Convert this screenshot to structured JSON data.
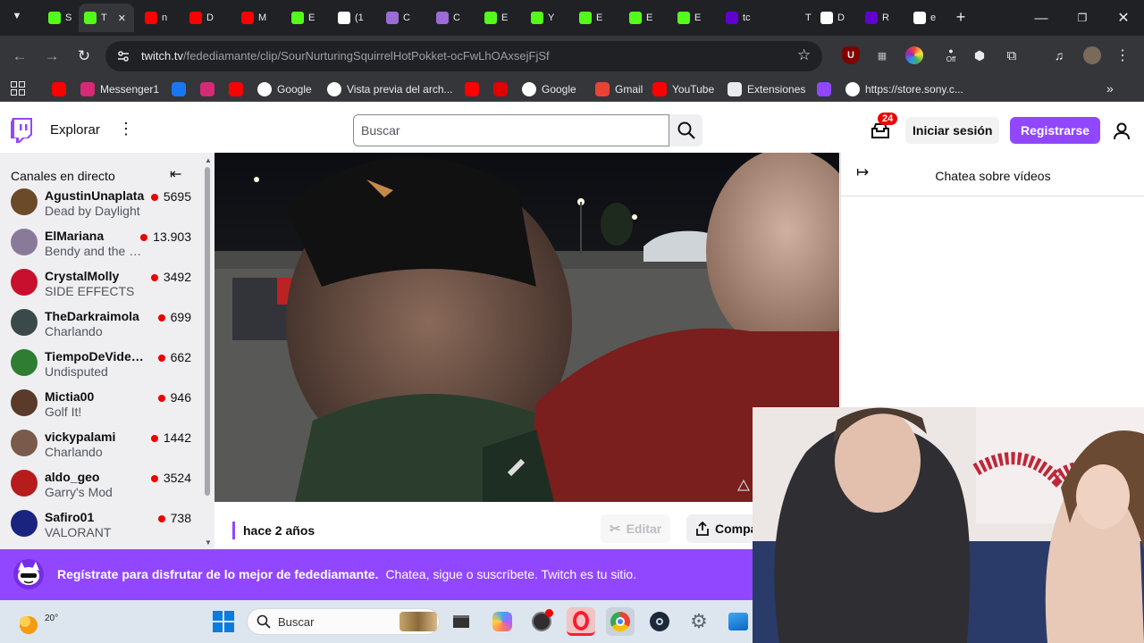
{
  "browser": {
    "tabs": [
      {
        "letter": "S",
        "icon": "kick-icon",
        "color": "#53fc18"
      },
      {
        "letter": "T",
        "icon": "kick-icon",
        "color": "#53fc18",
        "active": true
      },
      {
        "letter": "n",
        "icon": "youtube-icon",
        "color": "#ff0000"
      },
      {
        "letter": "D",
        "icon": "youtube-icon",
        "color": "#ff0000"
      },
      {
        "letter": "M",
        "icon": "youtube-icon",
        "color": "#ff0000"
      },
      {
        "letter": "E",
        "icon": "kick-icon",
        "color": "#53fc18"
      },
      {
        "letter": "(1",
        "icon": "tiktok-icon",
        "color": "#ffffff"
      },
      {
        "letter": "C",
        "icon": "feather-icon",
        "color": "#9b6bd6"
      },
      {
        "letter": "C",
        "icon": "feather-icon",
        "color": "#9b6bd6"
      },
      {
        "letter": "E",
        "icon": "kick-icon",
        "color": "#53fc18"
      },
      {
        "letter": "Y",
        "icon": "kick-icon",
        "color": "#53fc18"
      },
      {
        "letter": "E",
        "icon": "kick-icon",
        "color": "#53fc18"
      },
      {
        "letter": "E",
        "icon": "kick-icon",
        "color": "#53fc18"
      },
      {
        "letter": "E",
        "icon": "kick-icon",
        "color": "#53fc18"
      },
      {
        "letter": "tc",
        "icon": "yahoo-icon",
        "color": "#6001d2"
      },
      {
        "letter": "T",
        "icon": "blank-icon",
        "color": "#202124"
      },
      {
        "letter": "D",
        "icon": "tiktok-icon",
        "color": "#ffffff"
      },
      {
        "letter": "R",
        "icon": "yahoo-icon",
        "color": "#6001d2"
      },
      {
        "letter": "e",
        "icon": "google-icon",
        "color": "#ffffff"
      }
    ],
    "url_domain": "twitch.tv",
    "url_path": "/fedediamante/clip/SourNurturingSquirrelHotPokket-ocFwLhOAxsejFjSf",
    "bookmarks": [
      {
        "label": "",
        "icon": "youtube-icon",
        "color": "#ff0000"
      },
      {
        "label": "Messenger1",
        "icon": "instagram-icon",
        "color": "#d62976"
      },
      {
        "label": "",
        "icon": "facebook-icon",
        "color": "#1877f2"
      },
      {
        "label": "",
        "icon": "instagram-icon",
        "color": "#d62976"
      },
      {
        "label": "",
        "icon": "youtube-icon",
        "color": "#ff0000"
      },
      {
        "label": "Google",
        "icon": "google-icon",
        "color": "#ffffff"
      },
      {
        "label": "Vista previa del arch...",
        "icon": "globe-icon",
        "color": "#ffffff"
      },
      {
        "label": "",
        "icon": "youtube-icon",
        "color": "#ff0000"
      },
      {
        "label": "",
        "icon": "red-logo-icon",
        "color": "#e00000"
      },
      {
        "label": "Google",
        "icon": "google-icon",
        "color": "#ffffff"
      },
      {
        "label": "Gmail",
        "icon": "gmail-icon",
        "color": "#ea4335"
      },
      {
        "label": "YouTube",
        "icon": "youtube-icon",
        "color": "#ff0000"
      },
      {
        "label": "Extensiones",
        "icon": "puzzle-icon",
        "color": "#e8eaed"
      },
      {
        "label": "",
        "icon": "twitch-icon",
        "color": "#9147ff"
      },
      {
        "label": "https://store.sony.c...",
        "icon": "sony-icon",
        "color": "#ffffff"
      }
    ]
  },
  "twitch": {
    "accent": "#9147ff",
    "nav": {
      "explore": "Explorar",
      "search_placeholder": "Buscar",
      "notif_count": "24",
      "login": "Iniciar sesión",
      "signup": "Registrarse"
    },
    "sidebar": {
      "title": "Canales en directo",
      "channels": [
        {
          "name": "AgustinUnaplata",
          "game": "Dead by Daylight",
          "viewers": "5695",
          "avatar": "#6b4a2a"
        },
        {
          "name": "ElMariana",
          "game": "Bendy and the Ink Machine",
          "viewers": "13.903",
          "avatar": "#8a7a9a"
        },
        {
          "name": "CrystalMolly",
          "game": "SIDE EFFECTS",
          "viewers": "3492",
          "avatar": "#c8102e"
        },
        {
          "name": "TheDarkraimola",
          "game": "Charlando",
          "viewers": "699",
          "avatar": "#3a4a4a"
        },
        {
          "name": "TiempoDeVideojuegos",
          "game": "Undisputed",
          "viewers": "662",
          "avatar": "#2e7d32"
        },
        {
          "name": "Mictia00",
          "game": "Golf It!",
          "viewers": "946",
          "avatar": "#5a3a2a"
        },
        {
          "name": "vickypalami",
          "game": "Charlando",
          "viewers": "1442",
          "avatar": "#7a5a4a"
        },
        {
          "name": "aldo_geo",
          "game": "Garry's Mod",
          "viewers": "3524",
          "avatar": "#b71c1c"
        },
        {
          "name": "Safiro01",
          "game": "VALORANT",
          "viewers": "738",
          "avatar": "#1a237e"
        }
      ]
    },
    "clip": {
      "age": "hace 2 años",
      "edit": "Editar",
      "share": "Compartir"
    },
    "chat": {
      "title": "Chatea sobre vídeos"
    },
    "banner": {
      "bold": "Regístrate para disfrutar de lo mejor de fedediamante.",
      "text": "Chatea, sigue o suscríbete. Twitch es tu sitio."
    }
  },
  "taskbar": {
    "temperature": "20°",
    "search_label": "Buscar",
    "apps": [
      "windows-start-icon",
      "file-explorer-icon",
      "copilot-icon",
      "obs-icon",
      "opera-icon",
      "chrome-icon",
      "steam-icon",
      "settings-icon",
      "photos-icon"
    ]
  }
}
